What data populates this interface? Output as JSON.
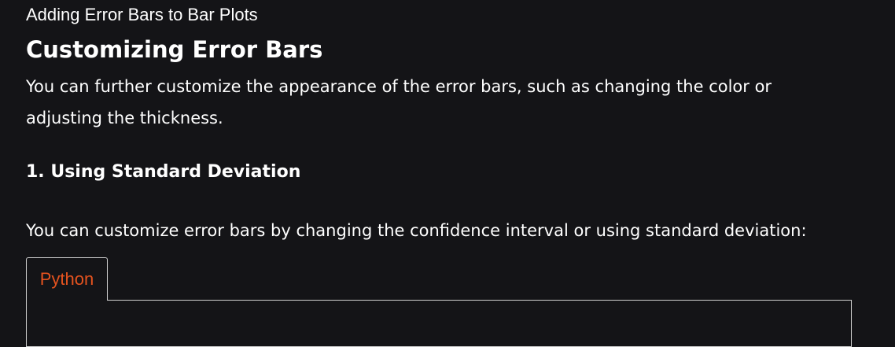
{
  "breadcrumb": "Adding Error Bars to Bar Plots",
  "section": {
    "title": "Customizing Error Bars",
    "intro": "You can further customize the appearance of the error bars, such as changing the color or adjusting the thickness."
  },
  "subsection": {
    "heading": "1. Using Standard Deviation",
    "text": "You can customize error bars by changing the confidence interval or using standard deviation:"
  },
  "code_block": {
    "tabs": [
      {
        "label": "Python"
      }
    ]
  },
  "colors": {
    "background": "#141417",
    "text": "#ffffff",
    "tab_accent": "#e5531f",
    "border": "#cfcfcf"
  }
}
